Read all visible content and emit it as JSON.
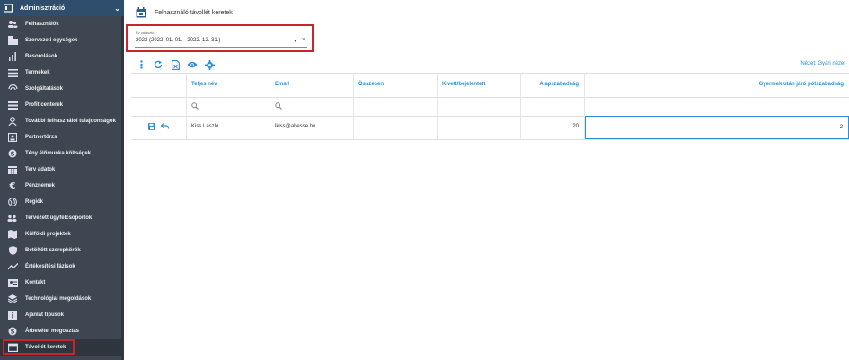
{
  "sidebar": {
    "header": {
      "title": "Adminisztráció",
      "icon": "admin-icon"
    },
    "items": [
      {
        "label": "Felhasználók",
        "icon": "users-icon"
      },
      {
        "label": "Szervezeti egységek",
        "icon": "org-units-icon"
      },
      {
        "label": "Besorolások",
        "icon": "bar-chart-icon"
      },
      {
        "label": "Termékek",
        "icon": "list-icon"
      },
      {
        "label": "Szolgáltatások",
        "icon": "service-icon"
      },
      {
        "label": "Profit centerek",
        "icon": "profit-center-icon"
      },
      {
        "label": "További felhasználói tulajdonságok",
        "icon": "user-properties-icon"
      },
      {
        "label": "Partnertörzs",
        "icon": "partner-icon"
      },
      {
        "label": "Tény élőmunka költségek",
        "icon": "dollar-icon"
      },
      {
        "label": "Terv adatok",
        "icon": "table-icon"
      },
      {
        "label": "Pénznemek",
        "icon": "euro-icon"
      },
      {
        "label": "Régiók",
        "icon": "globe-icon"
      },
      {
        "label": "Tervezett ügyfélcsoportok",
        "icon": "group-icon"
      },
      {
        "label": "Külföldi projektek",
        "icon": "map-icon"
      },
      {
        "label": "Betöltött szerepkörök",
        "icon": "shield-icon"
      },
      {
        "label": "Értékesítési fázisok",
        "icon": "trend-icon"
      },
      {
        "label": "Kontakt",
        "icon": "contact-card-icon"
      },
      {
        "label": "Technológiai megoldások",
        "icon": "layers-icon"
      },
      {
        "label": "Ajánlat típusok",
        "icon": "info-icon"
      },
      {
        "label": "Árbevétel megosztás",
        "icon": "revenue-icon"
      },
      {
        "label": "Távollét keretek",
        "icon": "calendar-icon",
        "active": true
      }
    ]
  },
  "page": {
    "title": "Felhasználó távollét keretek",
    "icon": "calendar-icon"
  },
  "filter": {
    "label": "Év választó",
    "value": "2022 (2022. 01. 01. - 2022. 12. 31.)",
    "clear": "×",
    "caret": "▾"
  },
  "toolbar": {
    "icons": [
      "more-vert-icon",
      "refresh-icon",
      "export-icon",
      "eye-icon",
      "gear-icon"
    ],
    "view_link": "Nézet: Gyári nézet"
  },
  "grid": {
    "columns": [
      "",
      "Teljes név",
      "Email",
      "Összesen",
      "Kivett/bejelentett",
      "Alapszabadság",
      "Gyermek után járó pótszabadság"
    ],
    "rows": [
      {
        "name": "Kiss László",
        "email": "lkiss@abesse.hu",
        "total": "",
        "taken": "",
        "base": "20",
        "child": "2"
      }
    ]
  },
  "colors": {
    "sidebar_bg": "#3d4651",
    "sidebar_header": "#2f4d6c",
    "accent": "#2a8fd6",
    "highlight": "#c7252b"
  }
}
